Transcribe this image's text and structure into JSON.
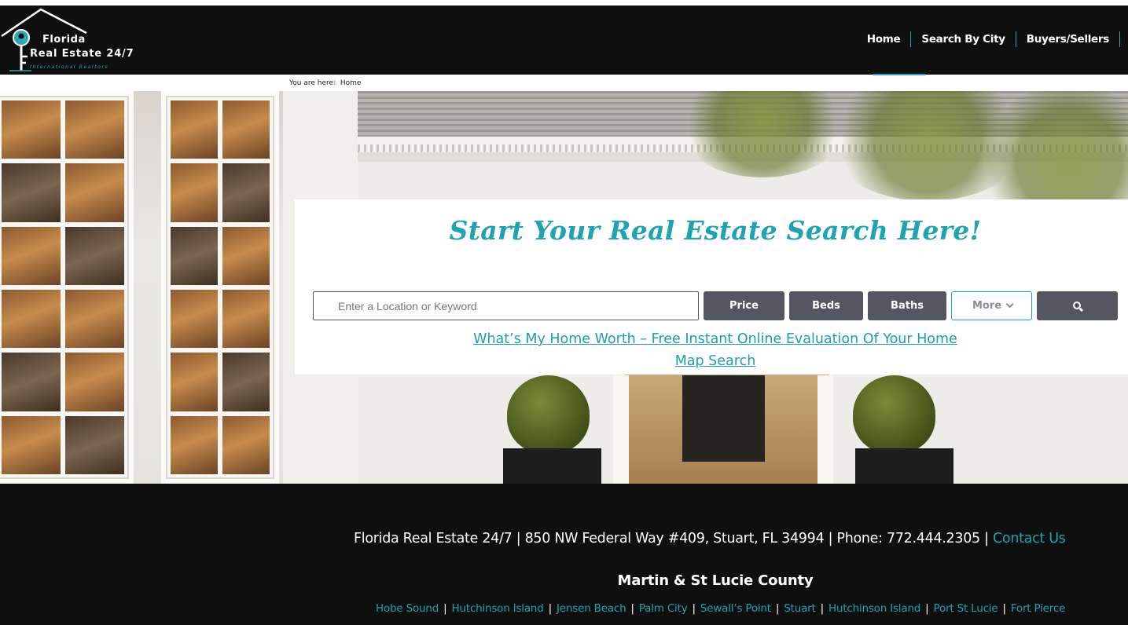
{
  "logo": {
    "line1": "Florida",
    "line2": "Real Estate 24/7",
    "line3": "International Realtors"
  },
  "nav": {
    "items": [
      {
        "label": "Home",
        "active": true
      },
      {
        "label": "Search By City"
      },
      {
        "label": "Buyers/Sellers"
      }
    ]
  },
  "breadcrumb": {
    "prefix": "You are here:",
    "current": "Home"
  },
  "search": {
    "title": "Start Your Real Estate Search Here!",
    "placeholder": "Enter a Location or Keyword",
    "price_label": "Price",
    "beds_label": "Beds",
    "baths_label": "Baths",
    "more_label": "More",
    "home_worth_link": "What’s My Home Worth – Free Instant Online Evaluation Of Your Home",
    "map_search_link": "Map Search"
  },
  "footer": {
    "company": "Florida Real Estate 24/7",
    "address": "850 NW Federal Way #409, Stuart, FL 34994",
    "phone": "Phone: 772.444.2305",
    "contact_label": "Contact Us",
    "county": "Martin & St Lucie County",
    "cities": [
      "Hobe Sound",
      "Hutchinson Island",
      "Jensen Beach",
      "Palm City",
      "Sewall’s Point",
      "Stuart",
      "Hutchinson Island",
      "Port St Lucie",
      "Fort Pierce"
    ]
  },
  "colors": {
    "accent": "#1fa3b1",
    "header_bg": "#0f0f0f",
    "button_bg": "#545762"
  }
}
